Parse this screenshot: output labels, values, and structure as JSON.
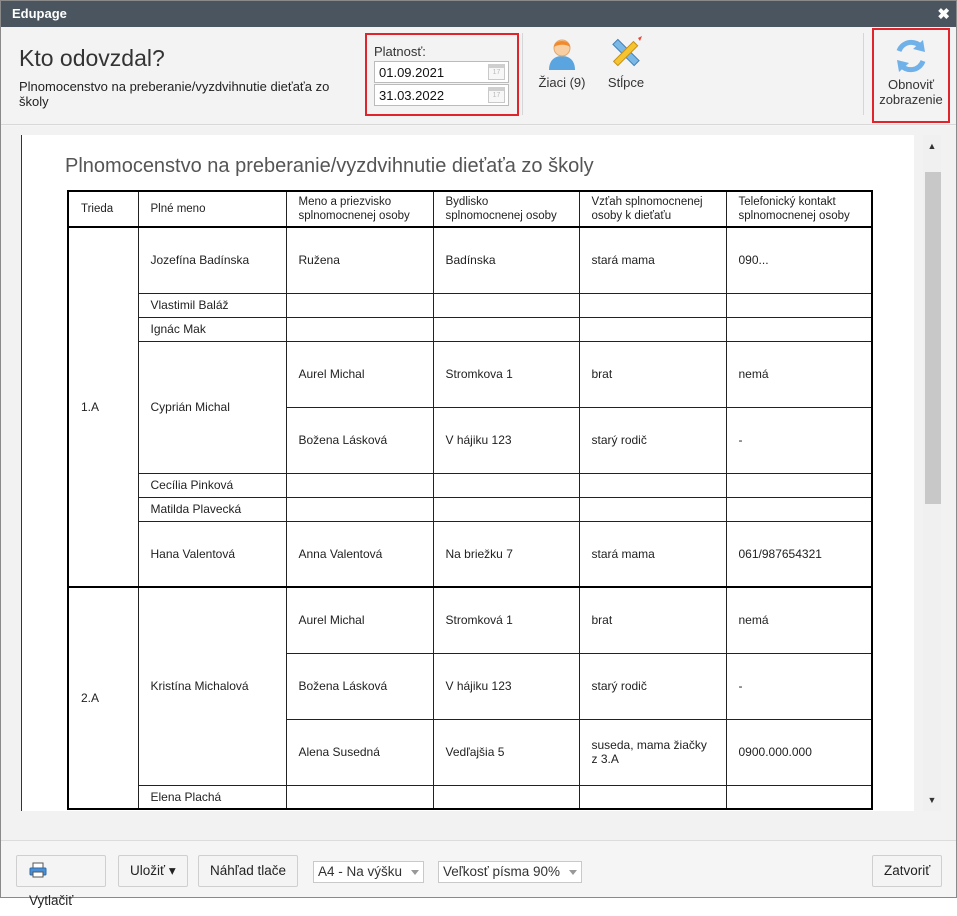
{
  "window": {
    "title": "Edupage",
    "close_symbol": "✖"
  },
  "header": {
    "title": "Kto odovzdal?",
    "subtitle": "Plnomocenstvo na preberanie/vyzdvihnutie dieťaťa zo školy"
  },
  "validity": {
    "label": "Platnosť:",
    "from": "01.09.2021",
    "to": "31.03.2022",
    "calendar_icon": "calendar-icon"
  },
  "toolbar": {
    "students_label": "Žiaci (9)",
    "columns_label": "Stĺpce",
    "refresh_label_1": "Obnoviť",
    "refresh_label_2": "zobrazenie"
  },
  "document": {
    "title": "Plnomocenstvo na preberanie/vyzdvihnutie dieťaťa zo školy",
    "columns": [
      "Trieda",
      "Plné meno",
      "Meno a priezvisko splnomocnenej osoby",
      "Bydlisko splnomocnenej osoby",
      "Vzťah splnomocnenej osoby k dieťaťu",
      "Telefonický kontakt splnomocnenej osoby"
    ],
    "groups": [
      {
        "class": "1.A",
        "students": [
          {
            "name": "Jozefína Badínska",
            "persons": [
              {
                "name": "Ružena",
                "address": "Badínska",
                "relation": "stará mama",
                "phone": "090..."
              }
            ]
          },
          {
            "name": "Vlastimil Baláž",
            "persons": []
          },
          {
            "name": "Ignác Mak",
            "persons": []
          },
          {
            "name": "Cyprián Michal",
            "persons": [
              {
                "name": "Aurel Michal",
                "address": "Stromkova 1",
                "relation": "brat",
                "phone": "nemá"
              },
              {
                "name": "Božena Lásková",
                "address": "V hájiku 123",
                "relation": "starý rodič",
                "phone": "-"
              }
            ]
          },
          {
            "name": "Cecília Pinková",
            "persons": []
          },
          {
            "name": "Matilda Plavecká",
            "persons": []
          },
          {
            "name": "Hana Valentová",
            "persons": [
              {
                "name": "Anna Valentová",
                "address": "Na briežku 7",
                "relation": "stará mama",
                "phone": "061/987654321"
              }
            ]
          }
        ]
      },
      {
        "class": "2.A",
        "students": [
          {
            "name": "Kristína Michalová",
            "persons": [
              {
                "name": "Aurel Michal",
                "address": "Stromková 1",
                "relation": "brat",
                "phone": "nemá"
              },
              {
                "name": "Božena Lásková",
                "address": "V hájiku 123",
                "relation": "starý rodič",
                "phone": "-"
              },
              {
                "name": "Alena Susedná",
                "address": "Vedľajšia 5",
                "relation": "suseda, mama žiačky z 3.A",
                "phone": "0900.000.000"
              }
            ]
          },
          {
            "name": "Elena Plachá",
            "persons": []
          }
        ]
      }
    ]
  },
  "footer": {
    "print_label": "Vytlačiť",
    "save_label": "Uložiť ▾",
    "preview_label": "Náhľad tlače",
    "paper_select": "A4 - Na výšku",
    "font_select": "Veľkosť písma 90%",
    "close_label": "Zatvoriť"
  },
  "scroll": {
    "up_symbol": "▲",
    "down_symbol": "▼"
  }
}
